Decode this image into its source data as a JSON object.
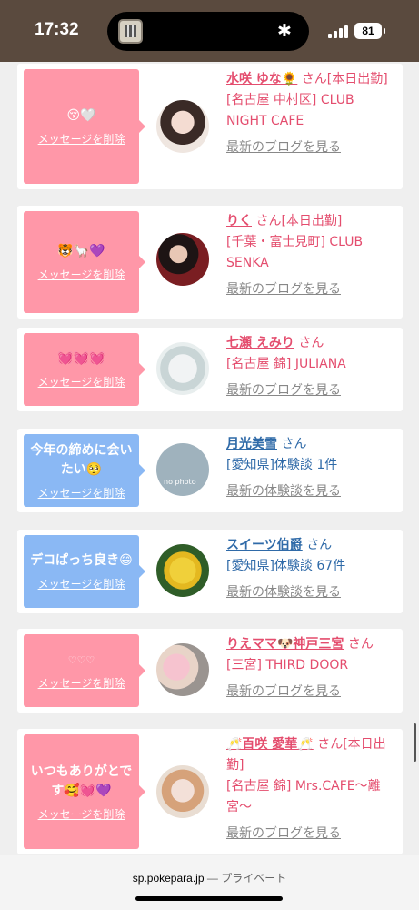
{
  "status": {
    "time": "17:32",
    "battery": "81",
    "bluetooth_icon": "bluetooth-icon",
    "signal_icon": "cellular-signal-icon"
  },
  "cards": [
    {
      "message": "😚🤍",
      "delete_label": "メッセージを削除",
      "name": "水咲 ゆな🌻",
      "san": "さん",
      "status": "[本日出勤]",
      "shop": "[名古屋 中村区] CLUB NIGHT CAFE",
      "link": "最新のブログを見る"
    },
    {
      "message": "🐯🦙💜",
      "delete_label": "メッセージを削除",
      "name": "りく",
      "san": "さん",
      "status": "[本日出勤]",
      "shop": "[千葉・富士見町] CLUB SENKA",
      "link": "最新のブログを見る"
    },
    {
      "message": "💓💓💓",
      "delete_label": "メッセージを削除",
      "name": "七瀬 えみり",
      "san": "さん",
      "status": "",
      "shop": "[名古屋 錦] JULIANA",
      "link": "最新のブログを見る"
    },
    {
      "message": "今年の締めに会いたい🥺",
      "delete_label": "メッセージを削除",
      "name": "月光美雪",
      "san": "さん",
      "status": "",
      "shop": "[愛知県]体験談 1件",
      "link": "最新の体験談を見る",
      "avatar_text": "no photo"
    },
    {
      "message": "デコぱっち良き😄",
      "delete_label": "メッセージを削除",
      "name": "スイーツ伯爵",
      "san": "さん",
      "status": "",
      "shop": "[愛知県]体験談 67件",
      "link": "最新の体験談を見る"
    },
    {
      "message": "♡♡♡",
      "delete_label": "メッセージを削除",
      "name": "りえママ🐶神戸三宮",
      "san": "さん",
      "status": "",
      "shop": "[三宮] THIRD DOOR",
      "link": "最新のブログを見る"
    },
    {
      "message": "いつもありがとです🥰💓💜",
      "delete_label": "メッセージを削除",
      "name": "🥂百咲 愛華🥂",
      "san": "さん",
      "status": "[本日出勤]",
      "shop": "[名古屋 錦] Mrs.CAFE〜離宮〜",
      "link": "最新のブログを見る"
    }
  ],
  "footer": {
    "domain": "sp.pokepara.jp",
    "separator": "—",
    "mode": "プライベート"
  },
  "colors": {
    "status_bar": "#5a4a3e",
    "pink_bubble": "#ff97a8",
    "blue_bubble": "#8ab8f4",
    "pink_text": "#e44d6e",
    "blue_text": "#2f6aa8"
  }
}
